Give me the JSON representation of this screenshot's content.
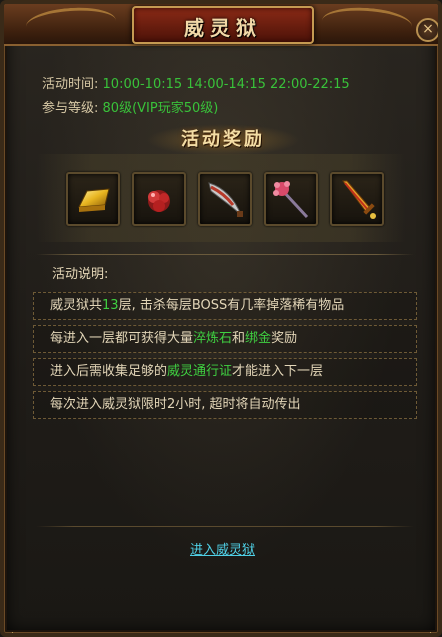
{
  "window": {
    "title": "威灵狱",
    "close_glyph": "×"
  },
  "info": {
    "time_label": "活动时间:",
    "time_value": "10:00-10:15 14:00-14:15 22:00-22:15",
    "level_label": "参与等级:",
    "level_value": "80级(VIP玩家50级)"
  },
  "rewards": {
    "title": "活动奖励",
    "items": [
      {
        "icon": "gold-bar-icon"
      },
      {
        "icon": "red-gem-icon"
      },
      {
        "icon": "blade-weapon-icon"
      },
      {
        "icon": "staff-weapon-icon"
      },
      {
        "icon": "sword-weapon-icon"
      }
    ]
  },
  "description": {
    "label": "活动说明:",
    "lines": [
      {
        "a": "威灵狱共",
        "b": "13",
        "c": "层, 击杀每层BOSS有几率掉落稀有物品"
      },
      {
        "a": "每进入一层都可获得大量",
        "b": "淬炼石",
        "c": "和",
        "d": "绑金",
        "e": "奖励"
      },
      {
        "a": "进入后需收集足够的",
        "b": "威灵通行证",
        "c": "才能进入下一层"
      },
      {
        "a": "每次进入威灵狱限时2小时, 超时将自动传出"
      }
    ]
  },
  "actions": {
    "enter_label": "进入威灵狱"
  },
  "colors": {
    "highlight": "#3fcf41",
    "link": "#4fd0e6",
    "text": "#e3d6b8"
  }
}
